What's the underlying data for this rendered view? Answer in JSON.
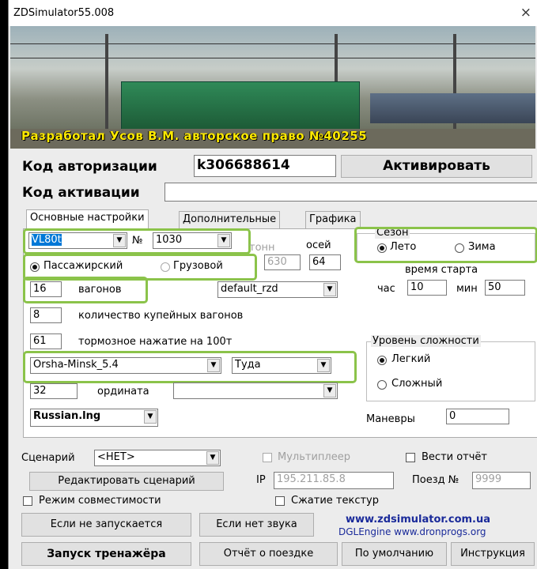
{
  "window": {
    "title": "ZDSimulator55.008",
    "close": "×"
  },
  "banner": {
    "credit": "Разработал Усов В.М. авторское право №40255"
  },
  "auth": {
    "code_label": "Код авторизации",
    "code_value": "k306688614",
    "activate_label": "Активировать",
    "activation_label": "Код активации",
    "activation_value": ""
  },
  "tabs": [
    "Основные настройки",
    "Дополнительные",
    "Графика"
  ],
  "main": {
    "loco": "VL80t",
    "num_label": "№",
    "num_value": "1030",
    "tons_label": "тонн",
    "tons_value": "630",
    "axles_label": "осей",
    "axles_value": "64",
    "passenger_label": "Пассажирский",
    "freight_label": "Грузовой",
    "wagons_value": "16",
    "wagons_label": "вагонов",
    "profile": "default_rzd",
    "compartment_value": "8",
    "compartment_label": "количество купейных вагонов",
    "brake_value": "61",
    "brake_label": "тормозное нажатие на 100т",
    "route": "Orsha-Minsk_5.4",
    "direction": "Туда",
    "ordinate_value": "32",
    "ordinate_label": "ордината",
    "ordinate_combo": "",
    "language": "Russian.lng"
  },
  "season": {
    "title": "Сезон",
    "summer": "Лето",
    "winter": "Зима"
  },
  "start_time": {
    "label": "время старта",
    "hour_label": "час",
    "hour_value": "10",
    "min_label": "мин",
    "min_value": "50"
  },
  "difficulty": {
    "title": "Уровень сложности",
    "easy": "Легкий",
    "hard": "Сложный"
  },
  "maneuvers": {
    "label": "Маневры",
    "value": "0"
  },
  "bottom": {
    "scenario_label": "Сценарий",
    "scenario_value": "<НЕТ>",
    "multiplayer_label": "Мультиплеер",
    "report_label": "Вести отчёт",
    "edit_scenario_label": "Редактировать сценарий",
    "ip_label": "IP",
    "ip_value": "195.211.85.8",
    "train_label": "Поезд №",
    "train_value": "9999",
    "compat_label": "Режим совместимости",
    "compress_label": "Сжатие текстур",
    "no_start_label": "Если не запускается",
    "no_sound_label": "Если нет звука",
    "site_main": "www.zdsimulator.com.ua",
    "site_engine": "DGLEngine www.dronprogs.org",
    "launch_label": "Запуск тренажёра",
    "trip_report_label": "Отчёт о поездке",
    "default_label": "По умолчанию",
    "manual_label": "Инструкция"
  },
  "colors": {
    "highlight": "#8bc34a",
    "link_blue": "#1a2a9a",
    "selection": "#0078d7"
  }
}
